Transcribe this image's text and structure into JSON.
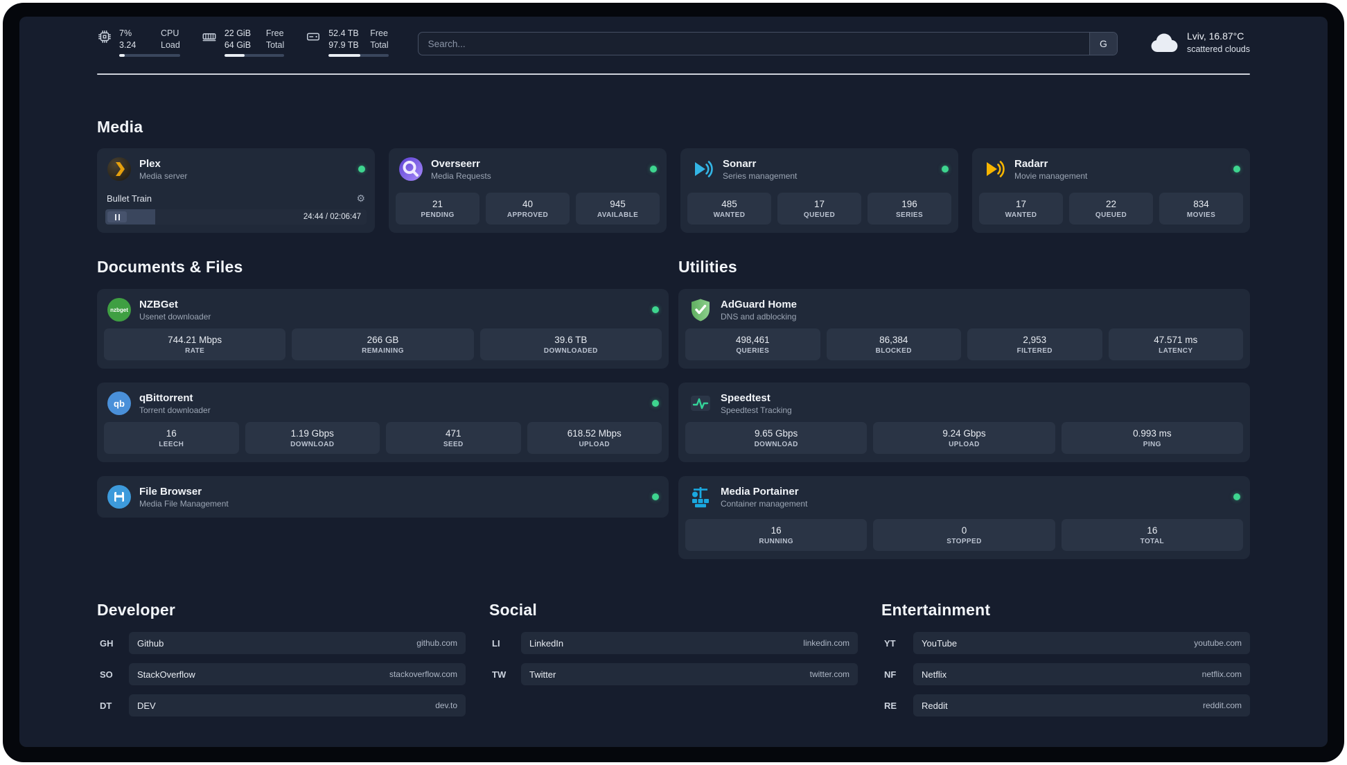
{
  "palette": {
    "page_bg": "#161d2d",
    "card_bg": "#202939",
    "stat_bg": "#2a3445",
    "status_online": "#3ed58f",
    "plex_amber": "#e5a00d",
    "overseerr_purple": "#7c5cdb",
    "sonarr_blue": "#33b5e5",
    "radarr_amber": "#f7b500",
    "adguard_green": "#68bc71",
    "portainer_blue": "#1aa8e0"
  },
  "header": {
    "cpu": {
      "value_top": "7%",
      "value_bottom": "3.24",
      "label_top": "CPU",
      "label_bottom": "Load",
      "progress": 9
    },
    "ram": {
      "value_top": "22 GiB",
      "value_bottom": "64 GiB",
      "label_top": "Free",
      "label_bottom": "Total",
      "progress": 34
    },
    "disk": {
      "value_top": "52.4 TB",
      "value_bottom": "97.9 TB",
      "label_top": "Free",
      "label_bottom": "Total",
      "progress": 53
    },
    "search": {
      "placeholder": "Search...",
      "engine_button": "G"
    },
    "weather": {
      "location": "Lviv, 16.87°C",
      "condition": "scattered clouds"
    }
  },
  "media": {
    "title": "Media",
    "plex": {
      "name": "Plex",
      "subtitle": "Media server",
      "now_playing": {
        "title": "Bullet Train",
        "time": "24:44 / 02:06:47",
        "progress": 19
      }
    },
    "overseerr": {
      "name": "Overseerr",
      "subtitle": "Media Requests",
      "stats": [
        {
          "value": "21",
          "label": "PENDING"
        },
        {
          "value": "40",
          "label": "APPROVED"
        },
        {
          "value": "945",
          "label": "AVAILABLE"
        }
      ]
    },
    "sonarr": {
      "name": "Sonarr",
      "subtitle": "Series management",
      "stats": [
        {
          "value": "485",
          "label": "WANTED"
        },
        {
          "value": "17",
          "label": "QUEUED"
        },
        {
          "value": "196",
          "label": "SERIES"
        }
      ]
    },
    "radarr": {
      "name": "Radarr",
      "subtitle": "Movie management",
      "stats": [
        {
          "value": "17",
          "label": "WANTED"
        },
        {
          "value": "22",
          "label": "QUEUED"
        },
        {
          "value": "834",
          "label": "MOVIES"
        }
      ]
    }
  },
  "documents": {
    "title": "Documents & Files",
    "nzbget": {
      "name": "NZBGet",
      "subtitle": "Usenet downloader",
      "logo_text": "nzbget",
      "stats": [
        {
          "value": "744.21 Mbps",
          "label": "RATE"
        },
        {
          "value": "266 GB",
          "label": "REMAINING"
        },
        {
          "value": "39.6 TB",
          "label": "DOWNLOADED"
        }
      ]
    },
    "qbittorrent": {
      "name": "qBittorrent",
      "subtitle": "Torrent downloader",
      "logo_text": "qb",
      "stats": [
        {
          "value": "16",
          "label": "LEECH"
        },
        {
          "value": "1.19 Gbps",
          "label": "DOWNLOAD"
        },
        {
          "value": "471",
          "label": "SEED"
        },
        {
          "value": "618.52 Mbps",
          "label": "UPLOAD"
        }
      ]
    },
    "filebrowser": {
      "name": "File Browser",
      "subtitle": "Media File Management"
    }
  },
  "utilities": {
    "title": "Utilities",
    "adguard": {
      "name": "AdGuard Home",
      "subtitle": "DNS and adblocking",
      "stats": [
        {
          "value": "498,461",
          "label": "QUERIES"
        },
        {
          "value": "86,384",
          "label": "BLOCKED"
        },
        {
          "value": "2,953",
          "label": "FILTERED"
        },
        {
          "value": "47.571 ms",
          "label": "LATENCY"
        }
      ]
    },
    "speedtest": {
      "name": "Speedtest",
      "subtitle": "Speedtest Tracking",
      "stats": [
        {
          "value": "9.65 Gbps",
          "label": "DOWNLOAD"
        },
        {
          "value": "9.24 Gbps",
          "label": "UPLOAD"
        },
        {
          "value": "0.993 ms",
          "label": "PING"
        }
      ]
    },
    "portainer": {
      "name": "Media Portainer",
      "subtitle": "Container management",
      "stats": [
        {
          "value": "16",
          "label": "RUNNING"
        },
        {
          "value": "0",
          "label": "STOPPED"
        },
        {
          "value": "16",
          "label": "TOTAL"
        }
      ]
    }
  },
  "bookmarks": {
    "developer": {
      "title": "Developer",
      "items": [
        {
          "abbr": "GH",
          "name": "Github",
          "url": "github.com"
        },
        {
          "abbr": "SO",
          "name": "StackOverflow",
          "url": "stackoverflow.com"
        },
        {
          "abbr": "DT",
          "name": "DEV",
          "url": "dev.to"
        }
      ]
    },
    "social": {
      "title": "Social",
      "items": [
        {
          "abbr": "LI",
          "name": "LinkedIn",
          "url": "linkedin.com"
        },
        {
          "abbr": "TW",
          "name": "Twitter",
          "url": "twitter.com"
        }
      ]
    },
    "entertainment": {
      "title": "Entertainment",
      "items": [
        {
          "abbr": "YT",
          "name": "YouTube",
          "url": "youtube.com"
        },
        {
          "abbr": "NF",
          "name": "Netflix",
          "url": "netflix.com"
        },
        {
          "abbr": "RE",
          "name": "Reddit",
          "url": "reddit.com"
        }
      ]
    }
  }
}
